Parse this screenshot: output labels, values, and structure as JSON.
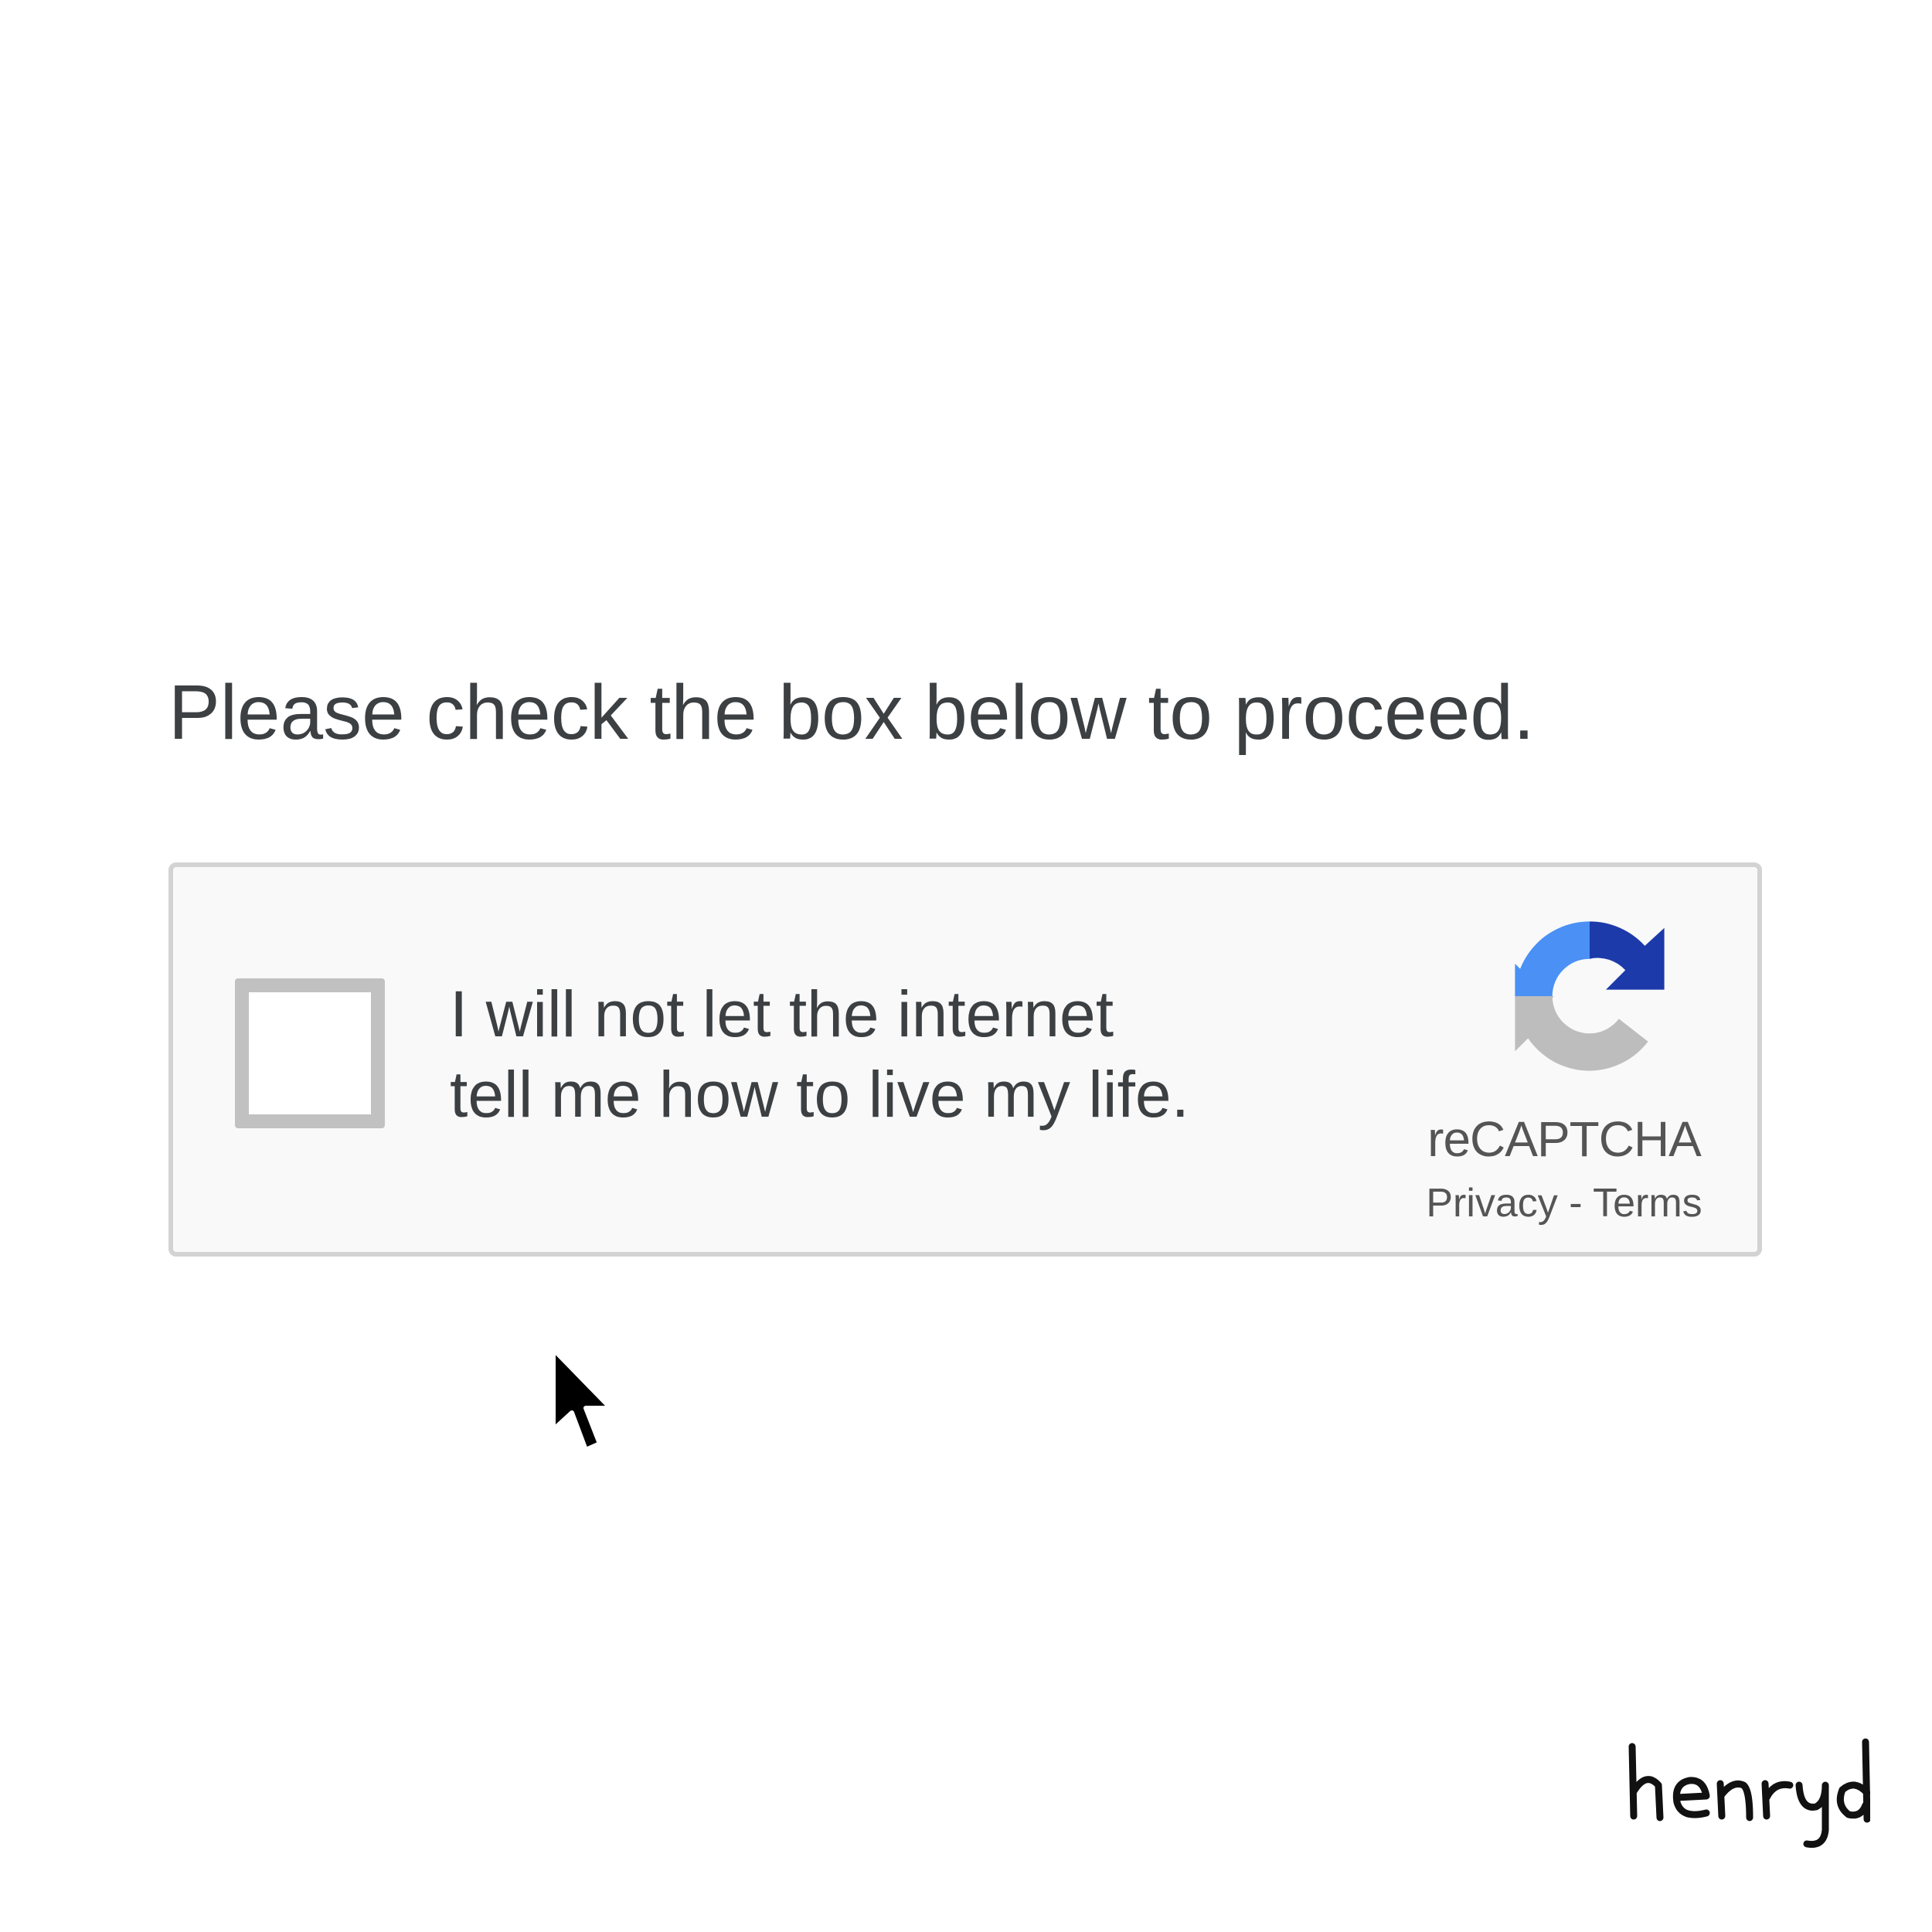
{
  "prompt": {
    "text": "Please check the box below to proceed."
  },
  "captcha": {
    "checked": false,
    "label_line1": "I will not let the internet",
    "label_line2": "tell me how to live my life.",
    "brand": "reCAPTCHA",
    "privacy_label": "Privacy",
    "separator": " - ",
    "terms_label": "Terms",
    "logo_icon": "recaptcha-logo-icon",
    "colors": {
      "blue_light": "#4a90f5",
      "blue_dark": "#1c3aa9",
      "gray": "#bdbdbd"
    }
  },
  "pointer": {
    "icon": "mouse-cursor-icon"
  },
  "signature": {
    "text": "henryd"
  }
}
